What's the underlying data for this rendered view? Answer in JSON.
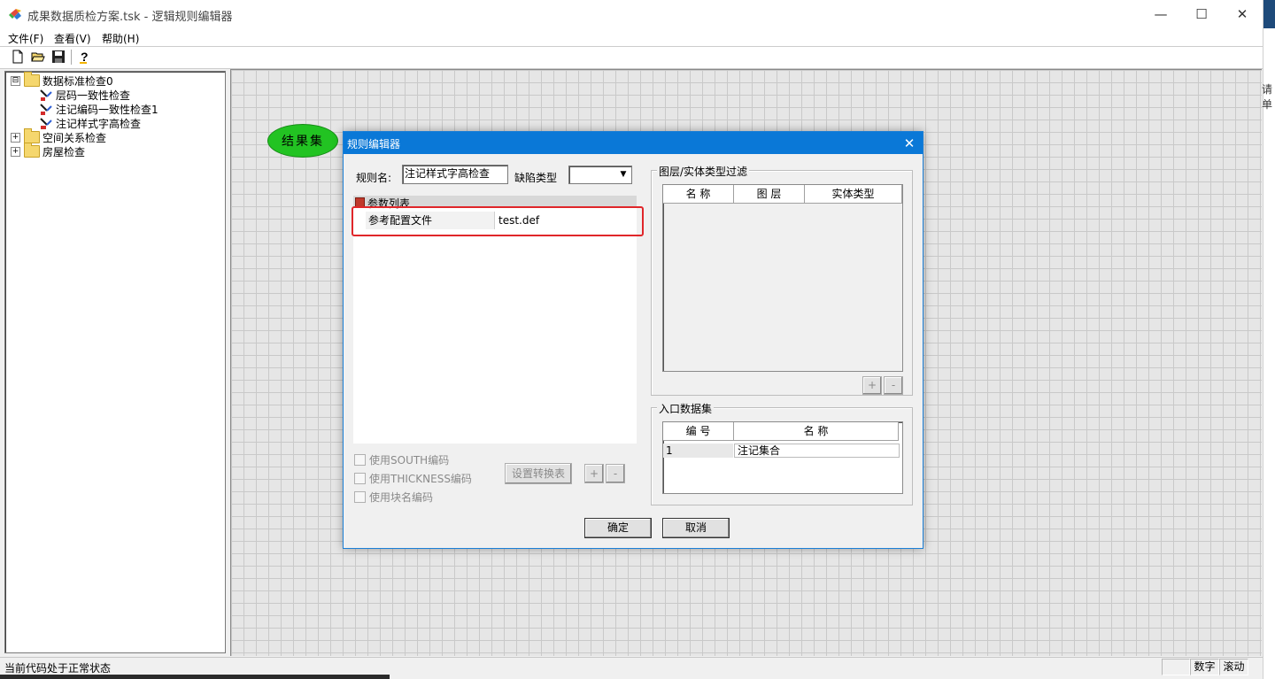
{
  "window": {
    "title": "成果数据质检方案.tsk - 逻辑规则编辑器",
    "minimize_glyph": "—",
    "maximize_glyph": "☐",
    "close_glyph": "✕"
  },
  "menu": [
    "文件(F)",
    "查看(V)",
    "帮助(H)"
  ],
  "toolbar": {
    "icons": [
      "new-file-icon",
      "open-folder-icon",
      "save-icon",
      "help-icon"
    ]
  },
  "right_strip_text": "请单",
  "tree": {
    "root": {
      "label": "数据标准检查0",
      "expander": "⊟"
    },
    "children": [
      "层码一致性检查",
      "注记编码一致性检查1",
      "注记样式字高检查"
    ],
    "groups": [
      {
        "label": "空间关系检查",
        "expander": "+"
      },
      {
        "label": "房屋检查",
        "expander": "+"
      }
    ]
  },
  "canvas": {
    "node_label": "结果集"
  },
  "status": {
    "text": "当前代码处于正常状态",
    "num": "数字",
    "scroll": "滚动"
  },
  "dialog": {
    "title": "规则编辑器",
    "close_glyph": "✕",
    "rule_name_label": "规则名:",
    "rule_name_value": "注记样式字高检查",
    "defect_type_label": "缺陷类型",
    "defect_type_value": "",
    "param_list_title": "参数列表",
    "param_name": "参考配置文件",
    "param_value": "test.def",
    "checkboxes": [
      "使用SOUTH编码",
      "使用THICKNESS编码",
      "使用块名编码"
    ],
    "set_convert_table": "设置转换表",
    "plus": "+",
    "minus": "-",
    "filter_group_title": "图层/实体类型过滤",
    "filter_columns": [
      "名 称",
      "图 层",
      "实体类型"
    ],
    "entry_group_title": "入口数据集",
    "entry_columns": [
      "编 号",
      "名 称"
    ],
    "entry_rows": [
      {
        "id": "1",
        "name": "注记集合"
      }
    ],
    "ok": "确定",
    "cancel": "取消"
  }
}
